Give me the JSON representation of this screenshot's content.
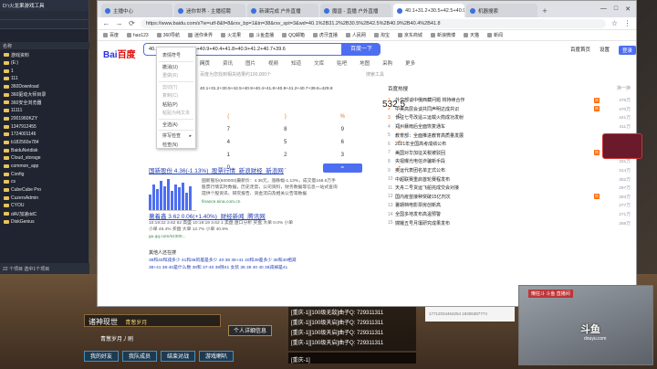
{
  "explorer": {
    "title": "D:\\火龙果游戏工具",
    "header": "名称",
    "items": [
      "游戏资料",
      "(E:)",
      "1",
      "111",
      "360Download",
      "360驱动大师目录",
      "360安全浏览器",
      "11111",
      "2001960KZY",
      "1347912455",
      "1724001146",
      "b182560e784",
      "BaiduNetdisk",
      "Cloud_storage",
      "common_app",
      "Config",
      "cs",
      "CubeCube Pro",
      "CuzersAdmin",
      "CYOU",
      "dAV加速ddC",
      "DiskGenius"
    ],
    "status": "22 个项目   选中1个项目"
  },
  "browser": {
    "tabs": [
      {
        "label": "主播中心"
      },
      {
        "label": "迷你世界 - 主播招聘"
      },
      {
        "label": "新课完成 户外直播"
      },
      {
        "label": "魔兽 - 直播 户外直播"
      },
      {
        "label": "40.1+31.2+30.5+42.5+40.9+40.4+41.8"
      },
      {
        "label": "机器搜索"
      }
    ],
    "url": "https://www.baidu.com/s?ie=utf-8&f=8&rsv_bp=1&tn=38&rsv_spt=3&wd=40.1%2B31.2%2B30.5%2B42.5%2B40.9%2B40.4%2B41.8",
    "bookmarks": [
      "百度",
      "hao123",
      "360导航",
      "迷你世界",
      "火龙果",
      "斗鱼直播",
      "QQ邮箱",
      "虎牙直播",
      "人民网",
      "淘宝",
      "京东商城",
      "新浪微博",
      "天猫",
      "新闻"
    ]
  },
  "baidu": {
    "logo_a": "Bai",
    "logo_b": "百度",
    "query": "40.1+31.2+30.5+42.5+40.9+40.4+41.8+40.9+41.2+40.7+39.6",
    "search_button": "百度一下",
    "header_links": [
      "百度首页",
      "设置"
    ],
    "login": "登录",
    "search_tabs": [
      "网页",
      "资讯",
      "图片",
      "视频",
      "知道",
      "文库",
      "贴吧",
      "地图",
      "采购",
      "更多"
    ],
    "result_count": "百度为您找到相关结果约100,000个",
    "tools": "搜索工具"
  },
  "context_menu": {
    "items": [
      {
        "label": "表情符号",
        "dim": false
      },
      {
        "label": "撤消(U)",
        "dim": false
      },
      {
        "label": "重做(R)",
        "dim": true
      },
      {
        "label": "剪切(T)",
        "dim": true
      },
      {
        "label": "复制(C)",
        "dim": true
      },
      {
        "label": "粘贴(P)",
        "dim": false
      },
      {
        "label": "粘贴为纯文本",
        "dim": true
      },
      {
        "label": "全选(A)",
        "dim": false
      },
      {
        "label": "拼写检查",
        "dim": false
      },
      {
        "label": "检查(N)",
        "dim": false
      }
    ]
  },
  "calculator": {
    "expression": "40.1+31.2+30.5+42.5+40.9+40.4+41.8+40.9+41.2+40.7+39.6=429.8",
    "result": "532.5",
    "keys": [
      "(",
      ")",
      "%",
      "C",
      "7",
      "8",
      "9",
      "÷",
      "4",
      "5",
      "6",
      "×",
      "1",
      "2",
      "3",
      "−",
      "0",
      ".",
      "=",
      "+"
    ]
  },
  "results": {
    "r1_title": "国新股份 4.36(-1.13%)_股票行情_新浪财经_新浪网",
    "r1_snippet_1": "国新股份(600000)最新价：4.36元，涨跌幅-1.13%，成交量168.5万手",
    "r1_snippet_2": "股票行情实时数据，历史走势，公司资料，财务数据等信息一站式查询",
    "r1_snippet_3": "提供个股资讯、研究报告、资金流向及相关公告等数据",
    "r1_source": "finance.sina.com.cn",
    "r1_bars": [
      18,
      30,
      24,
      34,
      28,
      36,
      22,
      30,
      26,
      32,
      20,
      28
    ],
    "r2_title": "著着鑫 3.62 0.06(+1.40%)_财经新闻_腾讯网",
    "r2_lines": [
      "10:19:22 3.62 62 高盛  10:19:19 3.62 1 卖盘  盘口分析 买盘 大单 0.0% 小单",
      "小单 46.4% 买盘 大单 12.7% 小单 40.9%"
    ],
    "r2_source": "gu.qq.com/sz300...",
    "related_head": "其他人还在搜",
    "related_rows": [
      "38和40和减多少   41和38的差是多少   40-38   38+41   40和39差多少   38和40相减",
      "38+41   38-40是什么数   38和   37-40   38除41   女装 36 38 40 40   38减掉是41"
    ]
  },
  "hot": {
    "title": "百度热搜",
    "refresh": "换一换",
    "items": [
      {
        "rank": "1",
        "text": "外交部谈中俄西藏问题 将持续合作",
        "hot": true,
        "num": "476万"
      },
      {
        "rank": "2",
        "text": "中美高层会谈共同声明达成共识",
        "hot": true,
        "num": "470万"
      },
      {
        "rank": "3",
        "text": "长征七号改遥三运载火箭成功发射",
        "hot": false,
        "num": "441万"
      },
      {
        "rank": "4",
        "text": "郑州暴雨后全面恢复通车",
        "hot": false,
        "num": "411万"
      },
      {
        "rank": "5",
        "text": "教育部：全面推进教育高质量发展",
        "hot": false,
        "num": "398万"
      },
      {
        "rank": "6",
        "text": "2021年全国高考成绩公布",
        "hot": false,
        "num": "376万"
      },
      {
        "rank": "7",
        "text": "美国对华加征关税被驳回",
        "hot": true,
        "num": "354万"
      },
      {
        "rank": "8",
        "text": "央视曝光电信诈骗新手段",
        "hot": false,
        "num": "331万"
      },
      {
        "rank": "9",
        "text": "奥运代表团名单正式公布",
        "hot": false,
        "num": "314万"
      },
      {
        "rank": "10",
        "text": "中超联赛重启首轮赛程发布",
        "hot": false,
        "num": "302万"
      },
      {
        "rank": "11",
        "text": "天舟二号货运飞船完成交会对接",
        "hot": false,
        "num": "297万"
      },
      {
        "rank": "12",
        "text": "国内疫苗接种突破15亿剂次",
        "hot": true,
        "num": "283万"
      },
      {
        "rank": "13",
        "text": "暑期档电影票房创新高",
        "hot": false,
        "num": "277万"
      },
      {
        "rank": "14",
        "text": "全国多地发布高温预警",
        "hot": false,
        "num": "271万"
      },
      {
        "rank": "15",
        "text": "嫦娥五号月壤研究成果发布",
        "hot": false,
        "num": "268万"
      }
    ]
  },
  "game_hud": {
    "player_name": "诸神现世",
    "guild": "青葱岁月",
    "sub": "青葱岁月丿刷",
    "info_button": "个人详细信息",
    "buttons": [
      "我的好友",
      "我队成员",
      "结束对战",
      "游戏喇叭"
    ],
    "chat": [
      "[重庆-1][100级无敌]曲子Q: 729311311",
      "[重庆-1][100级天启]曲子Q: 729311311",
      "[重庆-1][100级天启]曲子Q: 729311311",
      "[重庆-1][100级天启]曲子Q: 729311311"
    ],
    "chat_input": "[重庆-1]",
    "tray_text": "17712034464254  18306387774"
  },
  "stream": {
    "cam_label": "懒狂斗 斗鱼 直播间",
    "douyu": "斗鱼",
    "douyu_sub": "douyu.com"
  }
}
